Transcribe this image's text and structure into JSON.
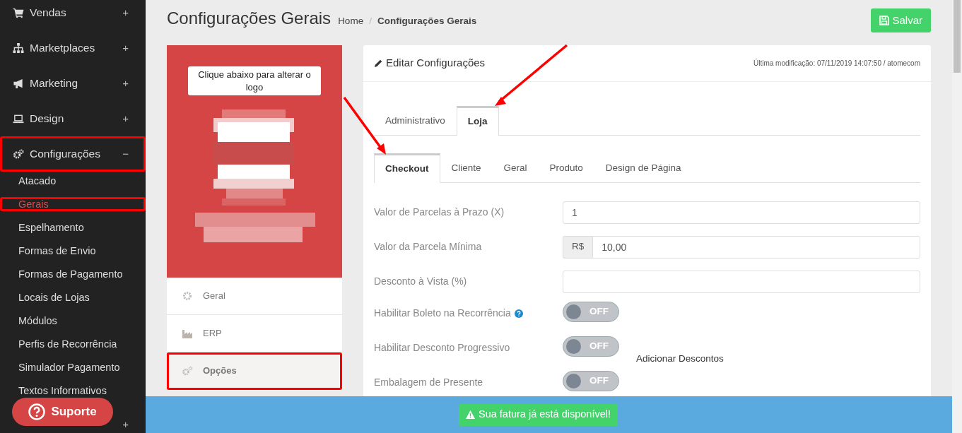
{
  "sidebar": {
    "items": [
      {
        "label": "Vendas",
        "sign": "+",
        "highlighted": false
      },
      {
        "label": "Marketplaces",
        "sign": "+",
        "highlighted": false
      },
      {
        "label": "Marketing",
        "sign": "+",
        "highlighted": false
      },
      {
        "label": "Design",
        "sign": "+",
        "highlighted": false
      },
      {
        "label": "Configurações",
        "sign": "−",
        "highlighted": true,
        "children": [
          {
            "label": "Atacado",
            "selected": false,
            "highlighted": false
          },
          {
            "label": "Gerais",
            "selected": true,
            "highlighted": true
          },
          {
            "label": "Espelhamento",
            "selected": false,
            "highlighted": false
          },
          {
            "label": "Formas de Envio",
            "selected": false,
            "highlighted": false
          },
          {
            "label": "Formas de Pagamento",
            "selected": false,
            "highlighted": false
          },
          {
            "label": "Locais de Lojas",
            "selected": false,
            "highlighted": false
          },
          {
            "label": "Módulos",
            "selected": false,
            "highlighted": false
          },
          {
            "label": "Perfis de Recorrência",
            "selected": false,
            "highlighted": false
          },
          {
            "label": "Simulador Pagamento",
            "selected": false,
            "highlighted": false
          },
          {
            "label": "Textos Informativos",
            "selected": false,
            "highlighted": false
          }
        ]
      },
      {
        "sign": "+"
      }
    ],
    "support_button": "Suporte"
  },
  "header": {
    "title": "Configurações Gerais",
    "breadcrumb": [
      "Home",
      "Configurações Gerais"
    ],
    "breadcrumb_separator": "/",
    "save_button": "Salvar"
  },
  "logo_panel": {
    "hint": "Clique abaixo para alterar o logo",
    "menu": [
      {
        "label": "Geral",
        "selected": false,
        "highlighted": false
      },
      {
        "label": "ERP",
        "selected": false,
        "highlighted": false
      },
      {
        "label": "Opções",
        "selected": true,
        "highlighted": true
      }
    ]
  },
  "settings_card": {
    "title": "Editar Configurações",
    "last_modified": "Última modificação: 07/11/2019 14:07:50 / atomecom",
    "tabs": [
      {
        "label": "Administrativo",
        "selected": false,
        "arrow": false
      },
      {
        "label": "Loja",
        "selected": true,
        "arrow": true
      }
    ],
    "subtabs": [
      {
        "label": "Checkout",
        "selected": true,
        "arrow": true
      },
      {
        "label": "Cliente",
        "selected": false,
        "arrow": false
      },
      {
        "label": "Geral",
        "selected": false,
        "arrow": false
      },
      {
        "label": "Produto",
        "selected": false,
        "arrow": false
      },
      {
        "label": "Design de Página",
        "selected": false,
        "arrow": false
      }
    ],
    "fields": [
      {
        "kind": "text",
        "label": "Valor de Parcelas à Prazo (X)",
        "value": "1"
      },
      {
        "kind": "money",
        "label": "Valor da Parcela Mínima",
        "prefix": "R$",
        "value": "10,00"
      },
      {
        "kind": "text",
        "label": "Desconto à Vista (%)"
      },
      {
        "kind": "toggle",
        "label": "Habilitar Boleto na Recorrência",
        "help": true,
        "on": false,
        "toggle_text": "OFF"
      },
      {
        "kind": "toggle",
        "label": "Habilitar Desconto Progressivo",
        "on": false,
        "toggle_text": "OFF",
        "link": "Adicionar Descontos"
      },
      {
        "kind": "toggle",
        "label": "Embalagem de Presente",
        "on": false,
        "toggle_text": "OFF"
      }
    ]
  },
  "notice": {
    "text": "Sua fatura já está disponível!"
  }
}
